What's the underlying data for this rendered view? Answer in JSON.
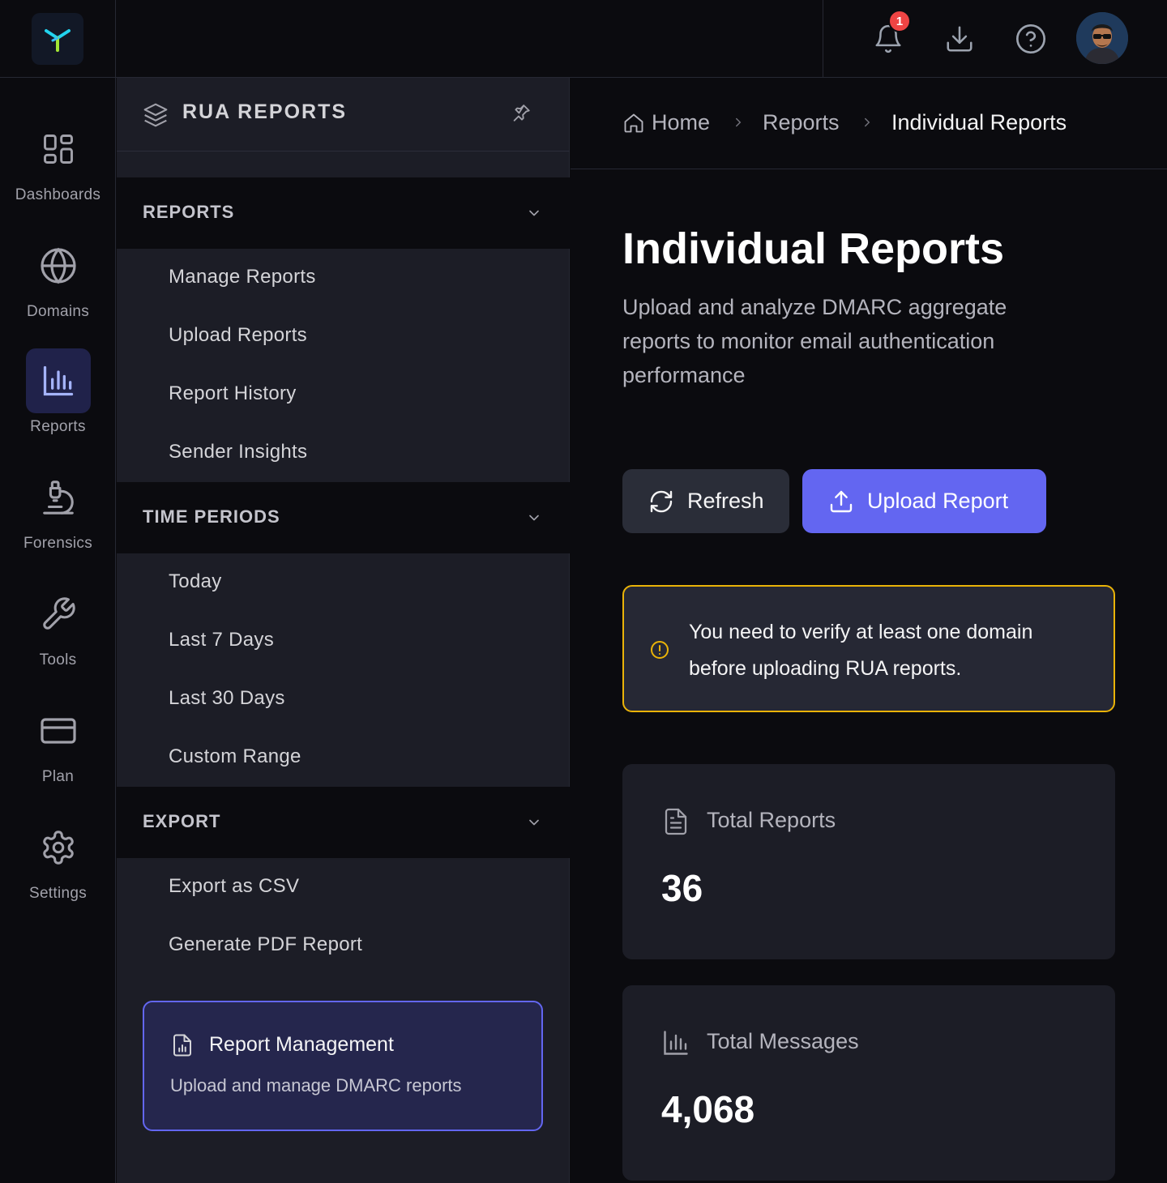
{
  "topbar": {
    "notification_count": "1",
    "icons": [
      "bell-icon",
      "download-icon",
      "help-icon"
    ]
  },
  "rail": {
    "items": [
      {
        "label": "Dashboards",
        "icon": "dashboard-icon"
      },
      {
        "label": "Domains",
        "icon": "globe-icon"
      },
      {
        "label": "Reports",
        "icon": "bar-chart-icon",
        "active": true
      },
      {
        "label": "Forensics",
        "icon": "microscope-icon"
      },
      {
        "label": "Tools",
        "icon": "wrench-icon"
      },
      {
        "label": "Plan",
        "icon": "credit-card-icon"
      },
      {
        "label": "Settings",
        "icon": "gear-icon"
      }
    ]
  },
  "sidebar": {
    "title": "RUA REPORTS",
    "sections": [
      {
        "label": "REPORTS",
        "links": [
          "Manage Reports",
          "Upload Reports",
          "Report History",
          "Sender Insights"
        ]
      },
      {
        "label": "TIME PERIODS",
        "links": [
          "Today",
          "Last 7 Days",
          "Last 30 Days",
          "Custom Range"
        ]
      },
      {
        "label": "EXPORT",
        "links": [
          "Export as CSV",
          "Generate PDF Report"
        ]
      }
    ],
    "promo": {
      "title": "Report Management",
      "subtitle": "Upload and manage DMARC reports"
    }
  },
  "breadcrumb": {
    "items": [
      "Home",
      "Reports",
      "Individual Reports"
    ]
  },
  "main": {
    "title": "Individual Reports",
    "description": "Upload and analyze DMARC aggregate reports to monitor email authentication performance",
    "refresh_label": "Refresh",
    "upload_label": "Upload Report",
    "alert": "You need to verify at least one domain before uploading RUA reports.",
    "stats": [
      {
        "label": "Total Reports",
        "value": "36",
        "icon": "document-icon"
      },
      {
        "label": "Total Messages",
        "value": "4,068",
        "icon": "bar-chart-icon"
      }
    ]
  },
  "colors": {
    "accent": "#6366f1",
    "warning": "#eab308",
    "badge": "#ef4444",
    "logo": "#22d3ee"
  }
}
